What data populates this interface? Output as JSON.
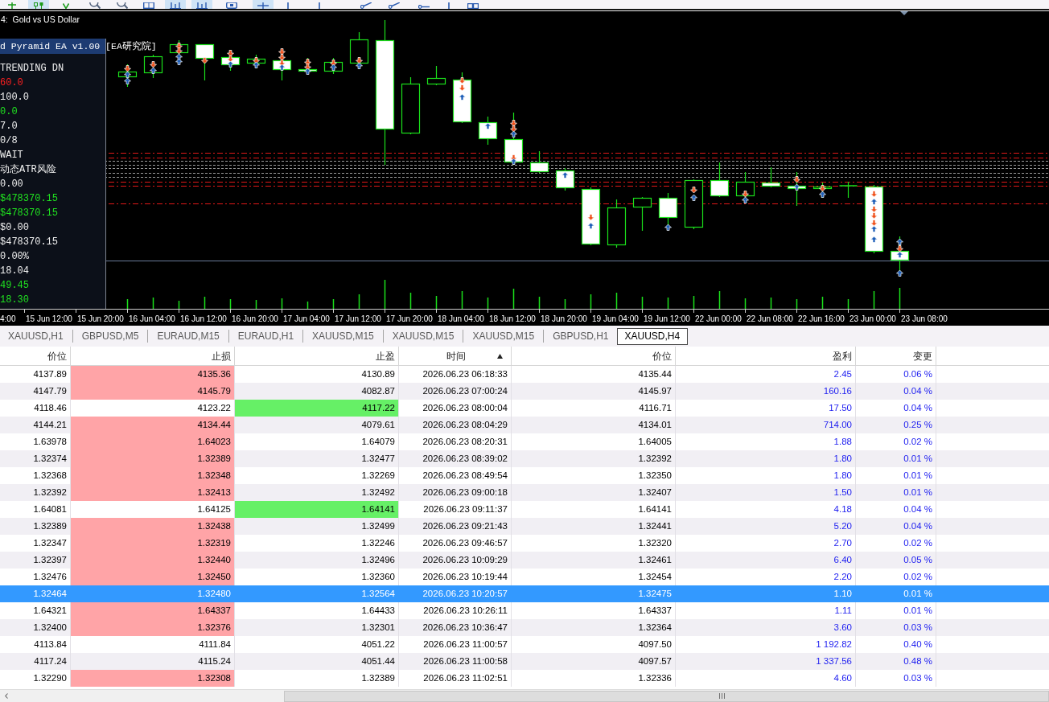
{
  "toolbar": {
    "buttons": [
      {
        "kind": "plus",
        "on": false
      },
      {
        "kind": "candlestick",
        "on": true
      },
      {
        "kind": "caret",
        "on": false
      },
      {
        "kind": "magnifier",
        "on": false
      },
      {
        "kind": "magnifier",
        "on": false
      },
      {
        "kind": "window",
        "on": false
      },
      {
        "kind": "bar_chart",
        "on": true
      },
      {
        "kind": "bar_chart",
        "on": true
      },
      {
        "kind": "frame",
        "on": false
      },
      {
        "kind": "crosshair",
        "on": true
      },
      {
        "kind": "vertical_line",
        "on": false
      },
      {
        "kind": "vertical_line",
        "on": false
      },
      {
        "kind": "trendline",
        "on": false
      },
      {
        "kind": "trendline",
        "on": false
      },
      {
        "kind": "horizontal_line",
        "on": false
      },
      {
        "kind": "vertical_line",
        "on": false
      },
      {
        "kind": "shapes",
        "on": false
      }
    ]
  },
  "chart": {
    "title": "4:  Gold vs US Dollar",
    "time_labels": [
      "4:00",
      "15 Jun 12:00",
      "15 Jun 20:00",
      "16 Jun 04:00",
      "16 Jun 12:00",
      "16 Jun 20:00",
      "17 Jun 04:00",
      "17 Jun 12:00",
      "17 Jun 20:00",
      "18 Jun 04:00",
      "18 Jun 12:00",
      "18 Jun 20:00",
      "19 Jun 04:00",
      "19 Jun 12:00",
      "22 Jun 00:00",
      "22 Jun 08:00",
      "22 Jun 16:00",
      "23 Jun 00:00",
      "23 Jun 08:00"
    ]
  },
  "ea_panel": {
    "title": "d Pyramid EA v1.00 [EA研究院]",
    "lines": [
      {
        "text": "TRENDING DN",
        "color": "#f0f0f0"
      },
      {
        "text": "60.0",
        "color": "#ff2020"
      },
      {
        "text": "100.0",
        "color": "#f0f0f0"
      },
      {
        "text": "0.0",
        "color": "#20e020"
      },
      {
        "text": "7.0",
        "color": "#f0f0f0"
      },
      {
        "text": "0/8",
        "color": "#f0f0f0"
      },
      {
        "text": "WAIT",
        "color": "#f0f0f0"
      },
      {
        "text": "动态ATR风险",
        "color": "#f0f0f0"
      },
      {
        "text": "0.00",
        "color": "#f0f0f0"
      },
      {
        "text": "$478370.15",
        "color": "#20e020"
      },
      {
        "text": "$478370.15",
        "color": "#20e020"
      },
      {
        "text": "$0.00",
        "color": "#f0f0f0"
      },
      {
        "text": "$478370.15",
        "color": "#f0f0f0"
      },
      {
        "text": "0.00%",
        "color": "#f0f0f0"
      },
      {
        "text": "18.04",
        "color": "#f0f0f0"
      },
      {
        "text": "49.45",
        "color": "#20e020"
      },
      {
        "text": "18.30",
        "color": "#20e020"
      }
    ]
  },
  "tabs": [
    {
      "label": "XAUUSD,H1",
      "selected": false
    },
    {
      "label": "GBPUSD,M5",
      "selected": false
    },
    {
      "label": "EURAUD,M15",
      "selected": false
    },
    {
      "label": "EURAUD,H1",
      "selected": false
    },
    {
      "label": "XAUUSD,M15",
      "selected": false
    },
    {
      "label": "XAUUSD,M15",
      "selected": false
    },
    {
      "label": "XAUUSD,M15",
      "selected": false
    },
    {
      "label": "GBPUSD,H1",
      "selected": false
    },
    {
      "label": "XAUUSD,H4",
      "selected": true
    }
  ],
  "table": {
    "columns": [
      {
        "label": "价位",
        "sorted": false
      },
      {
        "label": "止损",
        "sorted": false
      },
      {
        "label": "止盈",
        "sorted": false
      },
      {
        "label": "时间",
        "sorted": true
      },
      {
        "label": "价位",
        "sorted": false
      },
      {
        "label": "盈利",
        "sorted": false
      },
      {
        "label": "变更",
        "sorted": false
      }
    ],
    "rows": [
      {
        "price": "4137.89",
        "stop_loss": "4135.36",
        "take_profit": "4130.89",
        "time": "2026.06.23 06:18:33",
        "price_2": "4135.44",
        "profit": "2.45",
        "change": "0.06 %",
        "sl_marked": true,
        "tp_marked": false,
        "selected": false
      },
      {
        "price": "4147.79",
        "stop_loss": "4145.79",
        "take_profit": "4082.87",
        "time": "2026.06.23 07:00:24",
        "price_2": "4145.97",
        "profit": "160.16",
        "change": "0.04 %",
        "sl_marked": true,
        "tp_marked": false,
        "selected": false
      },
      {
        "price": "4118.46",
        "stop_loss": "4123.22",
        "take_profit": "4117.22",
        "time": "2026.06.23 08:00:04",
        "price_2": "4116.71",
        "profit": "17.50",
        "change": "0.04 %",
        "sl_marked": false,
        "tp_marked": true,
        "selected": false
      },
      {
        "price": "4144.21",
        "stop_loss": "4134.44",
        "take_profit": "4079.61",
        "time": "2026.06.23 08:04:29",
        "price_2": "4134.01",
        "profit": "714.00",
        "change": "0.25 %",
        "sl_marked": true,
        "tp_marked": false,
        "selected": false
      },
      {
        "price": "1.63978",
        "stop_loss": "1.64023",
        "take_profit": "1.64079",
        "time": "2026.06.23 08:20:31",
        "price_2": "1.64005",
        "profit": "1.88",
        "change": "0.02 %",
        "sl_marked": true,
        "tp_marked": false,
        "selected": false
      },
      {
        "price": "1.32374",
        "stop_loss": "1.32389",
        "take_profit": "1.32477",
        "time": "2026.06.23 08:39:02",
        "price_2": "1.32392",
        "profit": "1.80",
        "change": "0.01 %",
        "sl_marked": true,
        "tp_marked": false,
        "selected": false
      },
      {
        "price": "1.32368",
        "stop_loss": "1.32348",
        "take_profit": "1.32269",
        "time": "2026.06.23 08:49:54",
        "price_2": "1.32350",
        "profit": "1.80",
        "change": "0.01 %",
        "sl_marked": true,
        "tp_marked": false,
        "selected": false
      },
      {
        "price": "1.32392",
        "stop_loss": "1.32413",
        "take_profit": "1.32492",
        "time": "2026.06.23 09:00:18",
        "price_2": "1.32407",
        "profit": "1.50",
        "change": "0.01 %",
        "sl_marked": true,
        "tp_marked": false,
        "selected": false
      },
      {
        "price": "1.64081",
        "stop_loss": "1.64125",
        "take_profit": "1.64141",
        "time": "2026.06.23 09:11:37",
        "price_2": "1.64141",
        "profit": "4.18",
        "change": "0.04 %",
        "sl_marked": false,
        "tp_marked": true,
        "selected": false
      },
      {
        "price": "1.32389",
        "stop_loss": "1.32438",
        "take_profit": "1.32499",
        "time": "2026.06.23 09:21:43",
        "price_2": "1.32441",
        "profit": "5.20",
        "change": "0.04 %",
        "sl_marked": true,
        "tp_marked": false,
        "selected": false
      },
      {
        "price": "1.32347",
        "stop_loss": "1.32319",
        "take_profit": "1.32246",
        "time": "2026.06.23 09:46:57",
        "price_2": "1.32320",
        "profit": "2.70",
        "change": "0.02 %",
        "sl_marked": true,
        "tp_marked": false,
        "selected": false
      },
      {
        "price": "1.32397",
        "stop_loss": "1.32440",
        "take_profit": "1.32496",
        "time": "2026.06.23 10:09:29",
        "price_2": "1.32461",
        "profit": "6.40",
        "change": "0.05 %",
        "sl_marked": true,
        "tp_marked": false,
        "selected": false
      },
      {
        "price": "1.32476",
        "stop_loss": "1.32450",
        "take_profit": "1.32360",
        "time": "2026.06.23 10:19:44",
        "price_2": "1.32454",
        "profit": "2.20",
        "change": "0.02 %",
        "sl_marked": true,
        "tp_marked": false,
        "selected": false
      },
      {
        "price": "1.32464",
        "stop_loss": "1.32480",
        "take_profit": "1.32564",
        "time": "2026.06.23 10:20:57",
        "price_2": "1.32475",
        "profit": "1.10",
        "change": "0.01 %",
        "sl_marked": false,
        "tp_marked": false,
        "selected": true
      },
      {
        "price": "1.64321",
        "stop_loss": "1.64337",
        "take_profit": "1.64433",
        "time": "2026.06.23 10:26:11",
        "price_2": "1.64337",
        "profit": "1.11",
        "change": "0.01 %",
        "sl_marked": true,
        "tp_marked": false,
        "selected": false
      },
      {
        "price": "1.32400",
        "stop_loss": "1.32376",
        "take_profit": "1.32301",
        "time": "2026.06.23 10:36:47",
        "price_2": "1.32364",
        "profit": "3.60",
        "change": "0.03 %",
        "sl_marked": true,
        "tp_marked": false,
        "selected": false
      },
      {
        "price": "4113.84",
        "stop_loss": "4111.84",
        "take_profit": "4051.22",
        "time": "2026.06.23 11:00:57",
        "price_2": "4097.50",
        "profit": "1 192.82",
        "change": "0.40 %",
        "sl_marked": false,
        "tp_marked": false,
        "selected": false
      },
      {
        "price": "4117.24",
        "stop_loss": "4115.24",
        "take_profit": "4051.44",
        "time": "2026.06.23 11:00:58",
        "price_2": "4097.57",
        "profit": "1 337.56",
        "change": "0.48 %",
        "sl_marked": false,
        "tp_marked": false,
        "selected": false
      },
      {
        "price": "1.32290",
        "stop_loss": "1.32308",
        "take_profit": "1.32389",
        "time": "2026.06.23 11:02:51",
        "price_2": "1.32336",
        "profit": "4.60",
        "change": "0.03 %",
        "sl_marked": true,
        "tp_marked": false,
        "selected": false
      }
    ]
  }
}
